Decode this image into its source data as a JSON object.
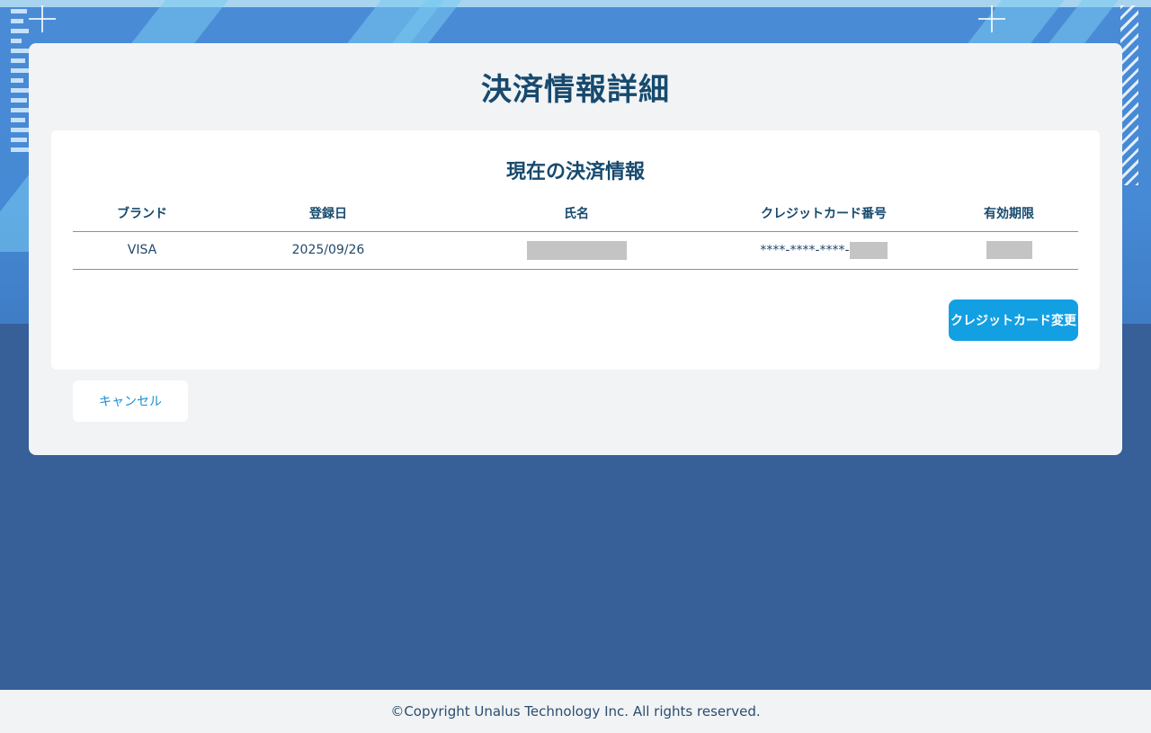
{
  "page": {
    "title": "決済情報詳細"
  },
  "payment_panel": {
    "title": "現在の決済情報",
    "columns": [
      "ブランド",
      "登録日",
      "氏名",
      "クレジットカード番号",
      "有効期限"
    ],
    "row": {
      "brand": "VISA",
      "registered_date": "2025/09/26",
      "card_number_prefix": "****-****-****-"
    },
    "change_card_label": "クレジットカード変更"
  },
  "actions": {
    "cancel_label": "キャンセル"
  },
  "footer": {
    "copyright": "©Copyright Unalus Technology Inc. All rights reserved."
  },
  "colors": {
    "primary_button": "#12a0e3",
    "heading_text": "#174a6e",
    "background": "#375f98",
    "redaction": "#c4c4c4"
  }
}
